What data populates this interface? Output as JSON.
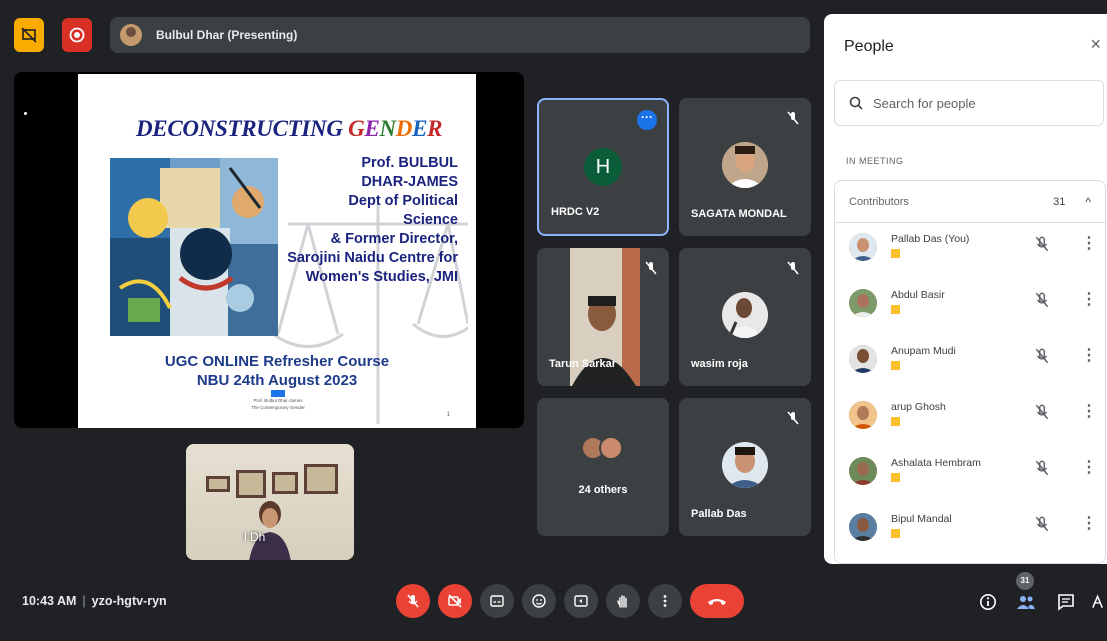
{
  "topbar": {
    "presenter_label": "Bulbul Dhar (Presenting)"
  },
  "slide": {
    "title_part1": "DECONSTRUCTING ",
    "title_part2_letters": [
      "G",
      "E",
      "N",
      "D",
      "E",
      "R"
    ],
    "presenter_block": "Prof. BULBUL\nDHAR-JAMES\nDept of Political\nScience\n& Former Director,\nSarojini Naidu Centre for\nWomen's Studies, JMI",
    "course_line1": "UGC ONLINE Refresher Course",
    "course_line2": "NBU 24th August 2023",
    "small_line1": "Prof. Bulbul Dhar-James",
    "small_line2": "The Contemporary Gender",
    "page_number": "1"
  },
  "selfview": {
    "name_fragment": "l Dh"
  },
  "tiles": {
    "hrdc": {
      "letter": "H",
      "name": "HRDC V2"
    },
    "sagata": {
      "name": "SAGATA MONDAL"
    },
    "tarun": {
      "name": "Tarun Sarkar"
    },
    "wasim": {
      "name": "wasim roja"
    },
    "others": {
      "label": "24 others"
    },
    "pallab": {
      "name": "Pallab Das"
    }
  },
  "panel": {
    "title": "People",
    "close_icon": "×",
    "search_placeholder": "Search for people",
    "section_label": "IN MEETING",
    "contributors_label": "Contributors",
    "contributors_count": "31",
    "collapse_icon": "^",
    "people": [
      {
        "name": "Pallab Das (You)"
      },
      {
        "name": "Abdul Basir"
      },
      {
        "name": "Anupam Mudi"
      },
      {
        "name": "arup Ghosh"
      },
      {
        "name": "Ashalata Hembram"
      },
      {
        "name": "Bipul Mandal"
      }
    ]
  },
  "bottombar": {
    "time": "10:43 AM",
    "separator": "|",
    "meeting_code": "yzo-hgtv-ryn",
    "people_count_badge": "31"
  },
  "colors": {
    "background": "#202124",
    "tile": "#3c4043",
    "danger": "#ea4335",
    "accent": "#8ab4f8"
  }
}
